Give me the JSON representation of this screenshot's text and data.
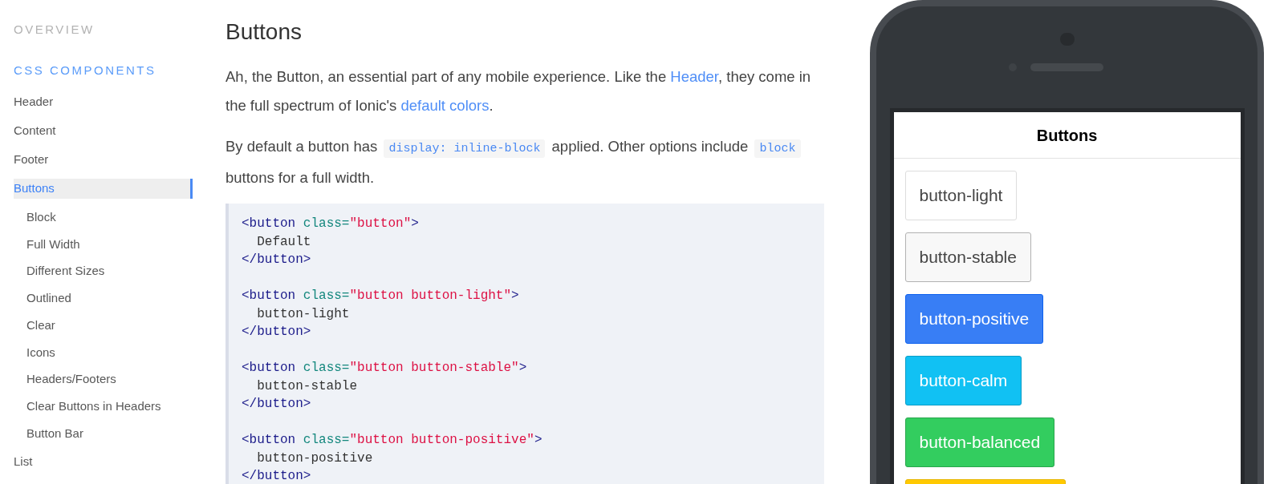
{
  "sidebar": {
    "sections": [
      {
        "title": "OVERVIEW",
        "active": false
      },
      {
        "title": "CSS COMPONENTS",
        "active": true,
        "items": [
          {
            "label": "Header",
            "selected": false
          },
          {
            "label": "Content",
            "selected": false
          },
          {
            "label": "Footer",
            "selected": false
          },
          {
            "label": "Buttons",
            "selected": true,
            "children": [
              {
                "label": "Block",
                "selected": false
              },
              {
                "label": "Full Width",
                "selected": false
              },
              {
                "label": "Different Sizes",
                "selected": false
              },
              {
                "label": "Outlined",
                "selected": false
              },
              {
                "label": "Clear",
                "selected": false
              },
              {
                "label": "Icons",
                "selected": false
              },
              {
                "label": "Headers/Footers",
                "selected": false
              },
              {
                "label": "Clear Buttons in Headers",
                "selected": false
              },
              {
                "label": "Button Bar",
                "selected": false
              }
            ]
          },
          {
            "label": "List",
            "selected": false
          }
        ]
      }
    ]
  },
  "article": {
    "title": "Buttons",
    "paragraphs": [
      {
        "segments": [
          {
            "kind": "text",
            "text": "Ah, the Button, an essential part of any mobile experience. Like the "
          },
          {
            "kind": "link",
            "text": "Header"
          },
          {
            "kind": "text",
            "text": ", they come in the full spectrum of Ionic's "
          },
          {
            "kind": "link",
            "text": "default colors"
          },
          {
            "kind": "text",
            "text": "."
          }
        ]
      },
      {
        "segments": [
          {
            "kind": "text",
            "text": "By default a button has "
          },
          {
            "kind": "code",
            "text": "display: inline-block"
          },
          {
            "kind": "text",
            "text": " applied. Other options include "
          },
          {
            "kind": "code",
            "text": "block"
          },
          {
            "kind": "text",
            "text": " buttons for a full width."
          }
        ]
      }
    ],
    "code_block": {
      "snippets": [
        {
          "lines": [
            [
              {
                "kind": "tag",
                "text": "<button"
              },
              {
                "kind": "attr",
                "text": " class="
              },
              {
                "kind": "string",
                "text": "\"button\""
              },
              {
                "kind": "tag",
                "text": ">"
              }
            ],
            [
              {
                "kind": "plain",
                "text": "  Default"
              }
            ],
            [
              {
                "kind": "tag",
                "text": "</button>"
              }
            ]
          ]
        },
        {
          "lines": [
            [
              {
                "kind": "tag",
                "text": "<button"
              },
              {
                "kind": "attr",
                "text": " class="
              },
              {
                "kind": "string",
                "text": "\"button button-light\""
              },
              {
                "kind": "tag",
                "text": ">"
              }
            ],
            [
              {
                "kind": "plain",
                "text": "  button-light"
              }
            ],
            [
              {
                "kind": "tag",
                "text": "</button>"
              }
            ]
          ]
        },
        {
          "lines": [
            [
              {
                "kind": "tag",
                "text": "<button"
              },
              {
                "kind": "attr",
                "text": " class="
              },
              {
                "kind": "string",
                "text": "\"button button-stable\""
              },
              {
                "kind": "tag",
                "text": ">"
              }
            ],
            [
              {
                "kind": "plain",
                "text": "  button-stable"
              }
            ],
            [
              {
                "kind": "tag",
                "text": "</button>"
              }
            ]
          ]
        },
        {
          "lines": [
            [
              {
                "kind": "tag",
                "text": "<button"
              },
              {
                "kind": "attr",
                "text": " class="
              },
              {
                "kind": "string",
                "text": "\"button button-positive\""
              },
              {
                "kind": "tag",
                "text": ">"
              }
            ],
            [
              {
                "kind": "plain",
                "text": "  button-positive"
              }
            ],
            [
              {
                "kind": "tag",
                "text": "</button>"
              }
            ]
          ]
        }
      ]
    }
  },
  "phone": {
    "header_title": "Buttons",
    "buttons": [
      {
        "kind": "light",
        "label": "button-light"
      },
      {
        "kind": "stable",
        "label": "button-stable"
      },
      {
        "kind": "positive",
        "label": "button-positive"
      },
      {
        "kind": "calm",
        "label": "button-calm"
      },
      {
        "kind": "balanced",
        "label": "button-balanced"
      },
      {
        "kind": "energized"
      }
    ]
  }
}
